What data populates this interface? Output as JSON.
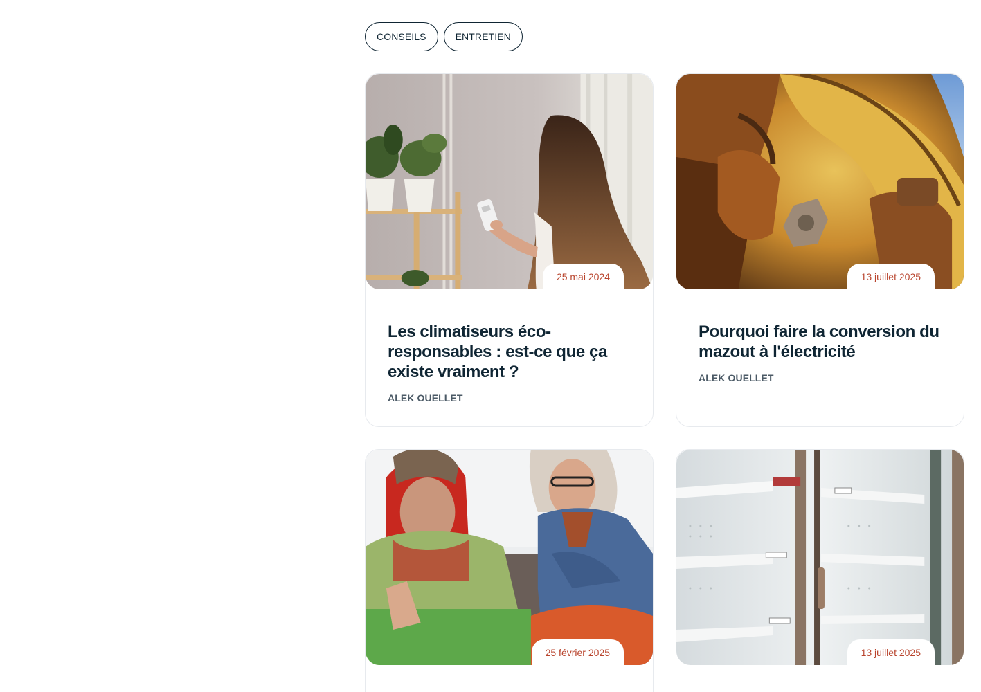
{
  "tags": [
    "CONSEILS",
    "ENTRETIEN"
  ],
  "articles": [
    {
      "date": "25 mai 2024",
      "title": "Les climatiseurs éco-responsables : est-ce que ça existe vraiment ?",
      "author": "ALEK OUELLET",
      "image": "woman-with-ac-remote-photo"
    },
    {
      "date": "13 juillet 2025",
      "title": "Pourquoi faire la conversion du mazout à l'électricité",
      "author": "ALEK OUELLET",
      "image": "rusty-oil-valve-photo"
    },
    {
      "date": "25 février 2025",
      "title": "",
      "author": "",
      "image": "cold-couple-in-blankets-photo"
    },
    {
      "date": "13 juillet 2025",
      "title": "",
      "author": "",
      "image": "empty-freezer-shelves-photo"
    }
  ],
  "colors": {
    "accent": "#b9452e",
    "text": "#0f2533",
    "muted": "#4b5a66",
    "border": "#e7eaee"
  }
}
